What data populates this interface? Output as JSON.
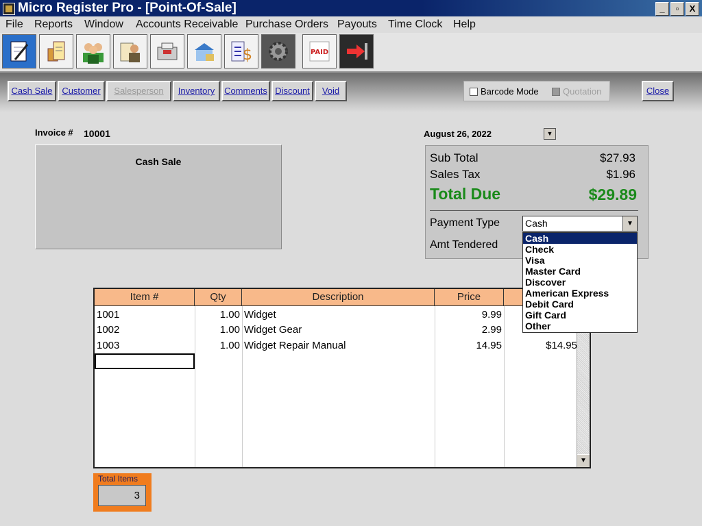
{
  "window": {
    "title": "Micro Register Pro - [Point-Of-Sale]",
    "controls": {
      "minimize": "_",
      "restore": "▫",
      "close": "X"
    }
  },
  "menu": [
    "File",
    "Reports",
    "Window",
    "Accounts Receivable",
    "Purchase Orders",
    "Payouts",
    "Time Clock",
    "Help"
  ],
  "toolbar_icons": [
    "notepad-icon",
    "clipboard-icon",
    "customers-icon",
    "employee-icon",
    "register-icon",
    "warehouse-icon",
    "checklist-money-icon",
    "gear-icon",
    "paid-invoice-icon",
    "exit-icon"
  ],
  "actions": {
    "cash_sale": "Cash Sale",
    "customer": "Customer",
    "salesperson": "Salesperson",
    "inventory": "Inventory",
    "comments": "Comments",
    "discount": "Discount",
    "void": "Void",
    "close": "Close"
  },
  "options": {
    "barcode_mode": "Barcode Mode",
    "barcode_checked": false,
    "quotation": "Quotation",
    "quotation_enabled": false
  },
  "invoice": {
    "label": "Invoice #",
    "number": "10001",
    "date": "August 26, 2022",
    "customer_name": "Cash Sale"
  },
  "totals": {
    "subtotal_label": "Sub Total",
    "subtotal": "$27.93",
    "tax_label": "Sales Tax",
    "tax": "$1.96",
    "total_label": "Total Due",
    "total": "$29.89",
    "payment_type_label": "Payment Type",
    "payment_type": "Cash",
    "amt_tendered_label": "Amt Tendered"
  },
  "payment_options": [
    "Cash",
    "Check",
    "Visa",
    "Master Card",
    "Discover",
    "American Express",
    "Debit Card",
    "Gift Card",
    "Other"
  ],
  "grid": {
    "headers": [
      "Item #",
      "Qty",
      "Description",
      "Price"
    ],
    "rows": [
      {
        "item": "1001",
        "qty": "1.00",
        "desc": "Widget",
        "price": "9.99",
        "ext": ""
      },
      {
        "item": "1002",
        "qty": "1.00",
        "desc": "Widget Gear",
        "price": "2.99",
        "ext": ""
      },
      {
        "item": "1003",
        "qty": "1.00",
        "desc": "Widget Repair Manual",
        "price": "14.95",
        "ext": "$14.95"
      }
    ]
  },
  "total_items": {
    "label": "Total Items",
    "value": "3"
  },
  "colors": {
    "accent_green": "#1a8a1a",
    "header_orange": "#f8b98a",
    "total_items_orange": "#f07c1e",
    "selection_blue": "#0a246a"
  }
}
